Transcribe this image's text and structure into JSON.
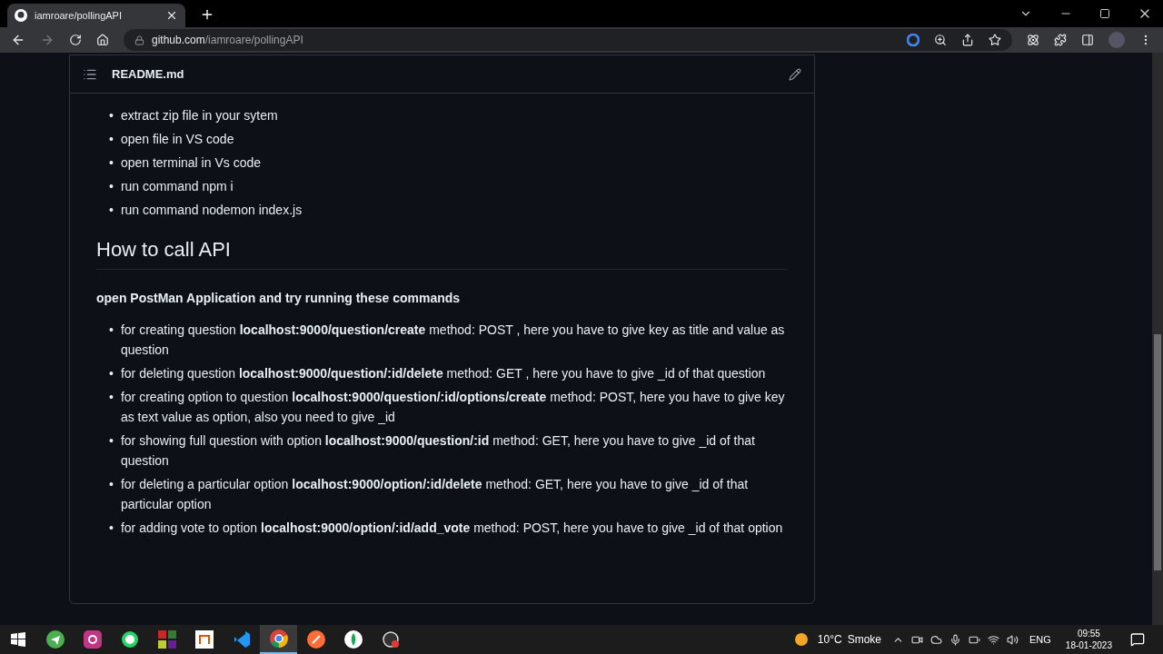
{
  "browser": {
    "tab": {
      "title": "iamroare/pollingAPI"
    },
    "url": {
      "host": "github.com",
      "path": "/iamroare/pollingAPI"
    }
  },
  "readme": {
    "filename": "README.md",
    "setup_steps": [
      {
        "marker": "•",
        "text": "extract zip file in your sytem"
      },
      {
        "marker": "•",
        "text": "open file in VS code"
      },
      {
        "marker": "•",
        "text": "open terminal in Vs code"
      },
      {
        "marker": "•",
        "text": "run command npm i"
      },
      {
        "marker": "•",
        "text": "run command nodemon index.js"
      }
    ],
    "heading": "How to call API",
    "intro": "open PostMan Application and try running these commands",
    "api_steps": [
      {
        "marker": "•",
        "text": "for creating question **localhost:9000/question/create** method: POST , here you have to give key as title and value as question"
      },
      {
        "marker": "•",
        "text": "for deleting question **localhost:9000/question/:id/delete** method: GET , here you have to give _id of that question"
      },
      {
        "marker": "•",
        "text": "for creating option to question **localhost:9000/question/:id/options/create** method: POST, here you have to give key as text value as option, also you need to give _id"
      },
      {
        "marker": "•",
        "text": "for showing full question with option **localhost:9000/question/:id** method: GET, here you have to give _id of that question"
      },
      {
        "marker": "•",
        "text": "for deleting a particular option **localhost:9000/option/:id/delete** method: GET, here you have to give _id of that particular option"
      },
      {
        "marker": "•",
        "text": "for adding vote to option **localhost:9000/option/:id/add_vote** method: POST, here you have to give _id of that option"
      }
    ]
  },
  "taskbar": {
    "apps": [
      {
        "kind": "telegram",
        "selected": false
      },
      {
        "kind": "instagram",
        "selected": false
      },
      {
        "kind": "whatsapp",
        "selected": false
      },
      {
        "kind": "tiles",
        "selected": false
      },
      {
        "kind": "notes",
        "selected": false
      },
      {
        "kind": "vscode",
        "selected": false
      },
      {
        "kind": "chrome",
        "selected": true
      },
      {
        "kind": "postman",
        "selected": false
      },
      {
        "kind": "mongodb",
        "selected": false
      },
      {
        "kind": "obs",
        "selected": false
      }
    ],
    "weather": {
      "temp": "10°C",
      "condition": "Smoke"
    },
    "language": "ENG",
    "time": "09:55",
    "date": "18-01-2023"
  }
}
